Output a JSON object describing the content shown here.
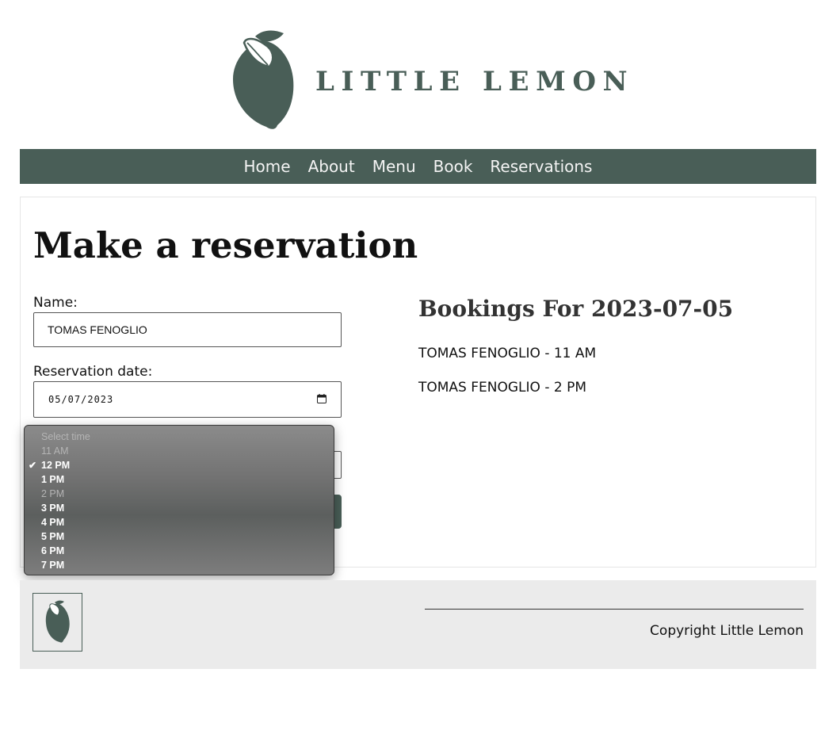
{
  "brand": {
    "name": "LITTLE LEMON",
    "color": "#495E57"
  },
  "nav": {
    "items": [
      "Home",
      "About",
      "Menu",
      "Book",
      "Reservations"
    ],
    "background": "#495E57"
  },
  "page": {
    "title": "Make a reservation"
  },
  "form": {
    "name_label": "Name:",
    "name_value": "TOMAS FENOGLIO",
    "date_label": "Reservation date:",
    "date_value": "05/07/2023"
  },
  "time_dropdown": {
    "options": [
      {
        "label": "Select time",
        "disabled": true,
        "selected": false
      },
      {
        "label": "11 AM",
        "disabled": true,
        "selected": false
      },
      {
        "label": "12 PM",
        "disabled": false,
        "selected": true
      },
      {
        "label": "1 PM",
        "disabled": false,
        "selected": false
      },
      {
        "label": "2 PM",
        "disabled": true,
        "selected": false
      },
      {
        "label": "3 PM",
        "disabled": false,
        "selected": false
      },
      {
        "label": "4 PM",
        "disabled": false,
        "selected": false
      },
      {
        "label": "5 PM",
        "disabled": false,
        "selected": false
      },
      {
        "label": "6 PM",
        "disabled": false,
        "selected": false
      },
      {
        "label": "7 PM",
        "disabled": false,
        "selected": false
      }
    ],
    "check_icon": "checkmark-icon"
  },
  "bookings": {
    "title": "Bookings For 2023-07-05",
    "items": [
      "TOMAS FENOGLIO - 11 AM",
      "TOMAS FENOGLIO - 2 PM"
    ]
  },
  "footer": {
    "copyright": "Copyright Little Lemon",
    "background": "#ebebeb"
  }
}
